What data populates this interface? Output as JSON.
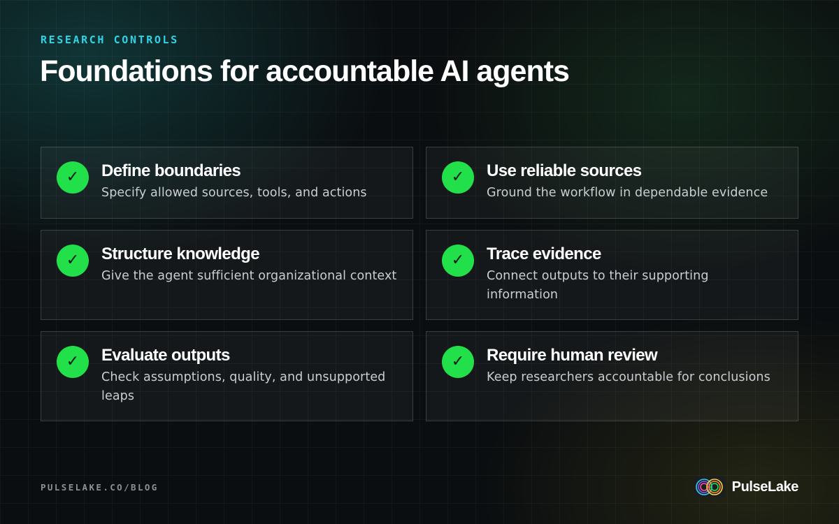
{
  "header": {
    "eyebrow": "RESEARCH CONTROLS",
    "title": "Foundations for accountable AI agents"
  },
  "cards": [
    {
      "icon": "checkmark-icon",
      "title": "Define boundaries",
      "description": "Specify allowed sources, tools, and actions"
    },
    {
      "icon": "checkmark-icon",
      "title": "Use reliable sources",
      "description": "Ground the workflow in dependable evidence"
    },
    {
      "icon": "checkmark-icon",
      "title": "Structure knowledge",
      "description": "Give the agent sufficient organizational context"
    },
    {
      "icon": "checkmark-icon",
      "title": "Trace evidence",
      "description": "Connect outputs to their supporting information"
    },
    {
      "icon": "checkmark-icon",
      "title": "Evaluate outputs",
      "description": "Check assumptions, quality, and unsupported leaps"
    },
    {
      "icon": "checkmark-icon",
      "title": "Require human review",
      "description": "Keep researchers accountable for conclusions"
    }
  ],
  "footer": {
    "url": "PULSELAKE.CO/BLOG",
    "brand_name": "PulseLake",
    "brand_logo_icon": "pulselake-logo-icon"
  },
  "colors": {
    "accent_cyan": "#2fd3e6",
    "check_green": "#22e04a",
    "background": "#0b0e10"
  }
}
